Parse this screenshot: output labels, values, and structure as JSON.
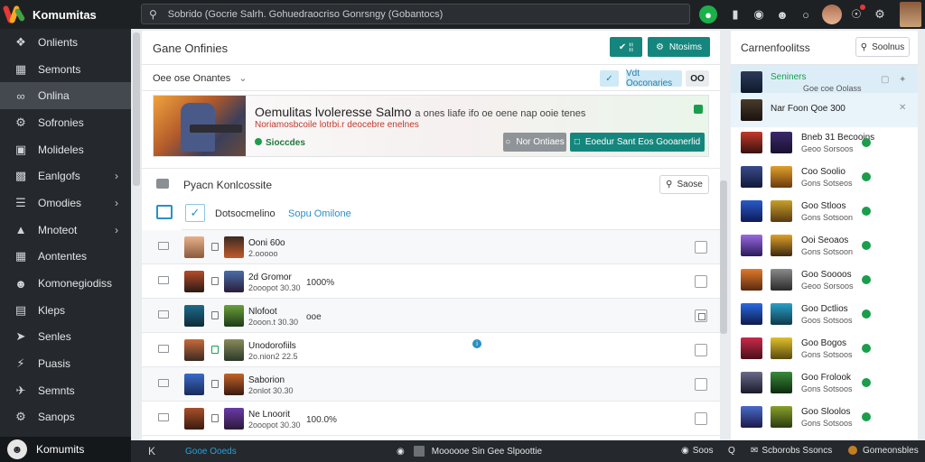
{
  "app": {
    "title": "Komumitas"
  },
  "search": {
    "value": "Sobrido (Gocrie Salrh. Gohuedraocriso Gonrsngy (Gobantocs)"
  },
  "sidebar": {
    "items": [
      {
        "label": "Onlients",
        "icon": "gamepad-icon"
      },
      {
        "label": "Semonts",
        "icon": "document-icon"
      },
      {
        "label": "Onlina",
        "icon": "link-icon"
      },
      {
        "label": "Sofronies",
        "icon": "wrench-icon"
      },
      {
        "label": "Molideles",
        "icon": "calendar-icon"
      },
      {
        "label": "Eanlgofs",
        "icon": "chart-icon"
      },
      {
        "label": "Omodies",
        "icon": "list-icon"
      },
      {
        "label": "Mnoteot",
        "icon": "triangle-icon"
      },
      {
        "label": "Aontentes",
        "icon": "grid-icon"
      },
      {
        "label": "Komonegiodiss",
        "icon": "people-icon"
      },
      {
        "label": "Kleps",
        "icon": "book-icon"
      },
      {
        "label": "Senles",
        "icon": "share-icon"
      },
      {
        "label": "Puasis",
        "icon": "bolt-icon"
      },
      {
        "label": "Semnts",
        "icon": "bell-icon"
      },
      {
        "label": "Sanops",
        "icon": "settings-icon"
      }
    ],
    "bottom_label": "Komumits"
  },
  "main": {
    "title": "Gane Onfinies",
    "header_btn1": "✔ ¦¦",
    "header_btn2": "Ntosims",
    "filter_label": "Oee ose Onantes",
    "filter_btn1": "✓",
    "filter_btn2": "Vdt Ooconaries",
    "filter_btn3": "OO",
    "banner": {
      "title": "Oemulitas lvoleresse Salmo",
      "title_tail": "a ones liafe ifo oe oene nap ooie tenes",
      "subtitle": "Noriamosbcoile lotrbi.r deocebre enelnes",
      "badge": "Sioccdes",
      "btn_more": "Nor Ontiaes",
      "btn_start": "Eoedur Sant Eos Gooanerlid"
    },
    "section": {
      "title": "Pyacn Konlcossite",
      "search": "Saose",
      "select_label": "Dotsocmelino",
      "select_link": "Sopu Omilone"
    },
    "rows": [
      {
        "t1": "Ooni 60o",
        "t2": "2.ooooo",
        "t3": ""
      },
      {
        "t1": "2d Gromor",
        "t2": "2ooopot 30.30",
        "t3": "1000%"
      },
      {
        "t1": "Nlofoot",
        "t2": "2ooon.t 30.30",
        "t3": "ooe"
      },
      {
        "t1": "Unodorofiils",
        "t2": "2o.nion2 22.5",
        "t3": ""
      },
      {
        "t1": "Saborion",
        "t2": "2onlot 30.30",
        "t3": ""
      },
      {
        "t1": "Ne Lnoorit",
        "t2": "2ooopot 30.30",
        "t3": "100.0%"
      }
    ]
  },
  "right": {
    "title": "Carnenfoolitss",
    "search": "Soolnus",
    "items": [
      {
        "t1": "Seniners",
        "t2": "Goe coe Oolass",
        "green_title": true
      },
      {
        "t1": "Nar Foon Qoe 300",
        "t2": ""
      },
      {
        "t1": "Bneb 31 Becooins",
        "t2": "Geoo Sorsoos"
      },
      {
        "t1": "Coo Soolio",
        "t2": "Gons Sotseos"
      },
      {
        "t1": "Goo Stloos",
        "t2": "Gons Sotsoon"
      },
      {
        "t1": "Ooi Seoaos",
        "t2": "Gons Sotsoon"
      },
      {
        "t1": "Goo Soooos",
        "t2": "Geoo Sorsoos"
      },
      {
        "t1": "Goo Dctlios",
        "t2": "Goos Sotsoos"
      },
      {
        "t1": "Goo Bogos",
        "t2": "Gons Sotsoos"
      },
      {
        "t1": "Goo Frolook",
        "t2": "Gons Sotsoos"
      },
      {
        "t1": "Goo Sloolos",
        "t2": "Gons Sotsoos"
      }
    ]
  },
  "bottombar": {
    "back": "K",
    "link": "Gooe Ooeds",
    "status": "Moooooe Sin Gee Slpoottie",
    "r1": "Soos",
    "r2": "Q",
    "r3": "Scborobs Ssoncs",
    "r4": "Gomeonsbles"
  },
  "colors": {
    "accent": "#15867d",
    "sidebar": "#25292d",
    "topbar": "#1e2124",
    "online": "#1a9e4b",
    "link": "#2a90c4"
  }
}
